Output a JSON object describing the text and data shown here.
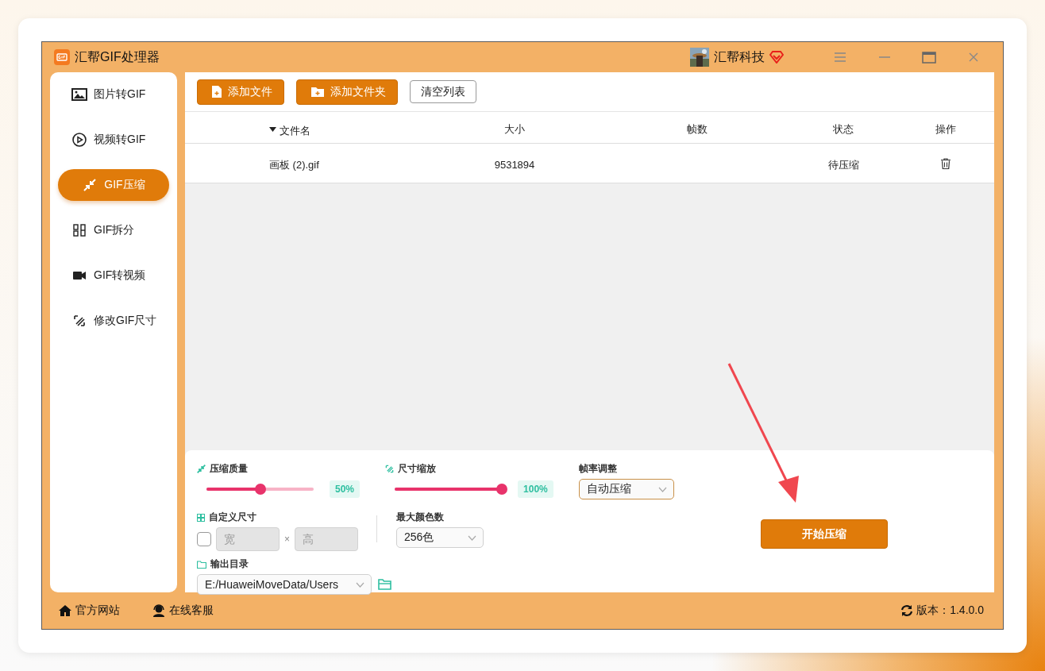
{
  "window": {
    "title": "汇帮GIF处理器",
    "user": "汇帮科技"
  },
  "sidebar": {
    "items": [
      {
        "label": "图片转GIF",
        "selected": false
      },
      {
        "label": "视频转GIF",
        "selected": false
      },
      {
        "label": "GIF压缩",
        "selected": true
      },
      {
        "label": "GIF拆分",
        "selected": false
      },
      {
        "label": "GIF转视频",
        "selected": false
      },
      {
        "label": "修改GIF尺寸",
        "selected": false
      }
    ]
  },
  "toolbar": {
    "buttons": [
      {
        "label": "添加文件",
        "kind": "file"
      },
      {
        "label": "添加文件夹",
        "kind": "folder"
      },
      {
        "label": "清空列表",
        "kind": "plain"
      }
    ]
  },
  "table": {
    "columns": [
      "文件名",
      "大小",
      "帧数",
      "状态",
      "操作"
    ],
    "rows": [
      {
        "name": "画板 (2).gif",
        "size": "9531894",
        "status": "待压缩"
      }
    ]
  },
  "settings": {
    "quality": {
      "label": "压缩质量",
      "level": 0.5,
      "reading": "50%"
    },
    "scale": {
      "label": "尺寸缩放",
      "level": 1.0,
      "reading": "100%"
    },
    "frame_rate": {
      "label": "帧率调整",
      "value": "自动压缩"
    },
    "custom_size": {
      "label": "自定义尺寸",
      "checked": false,
      "width_placeholder": "宽",
      "separator": "×",
      "height_placeholder": "高"
    },
    "max_colors": {
      "label": "最大颜色数",
      "value": "256色"
    },
    "output": {
      "label": "输出目录",
      "value": "E:/HuaweiMoveData/Users"
    },
    "start_button": "开始压缩"
  },
  "footer": {
    "links": [
      {
        "label": "官方网站"
      },
      {
        "label": "在线客服"
      }
    ],
    "version": "版本：1.4.0.0"
  }
}
